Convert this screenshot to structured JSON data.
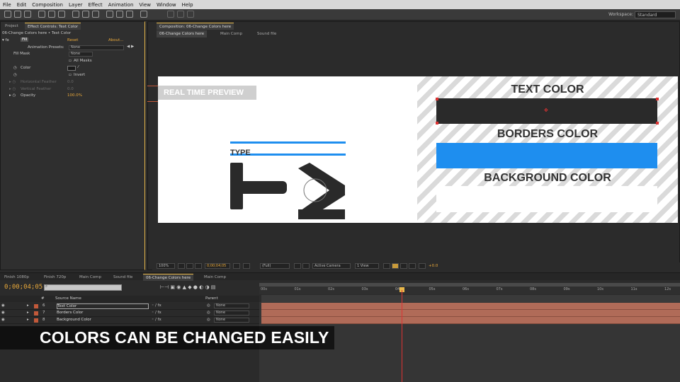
{
  "menu": {
    "items": [
      "File",
      "Edit",
      "Composition",
      "Layer",
      "Effect",
      "Animation",
      "View",
      "Window",
      "Help"
    ]
  },
  "workspace": {
    "label": "Workspace:",
    "value": "Standard"
  },
  "left_panel": {
    "tabs": [
      "Project",
      "Effect Controls: Text Color"
    ],
    "breadcrumb": "06-Change Colors here • Text Color",
    "effect": {
      "name": "Fill",
      "reset": "Reset",
      "about": "About..."
    },
    "animation_presets_label": "Animation Presets:",
    "animation_presets_value": "None",
    "fill_mask_label": "Fill Mask",
    "fill_mask_value": "None",
    "all_masks_label": "All Masks",
    "color_label": "Color",
    "invert_label": "Invert",
    "h_feather_label": "Horizontal Feather",
    "h_feather_value": "0.0",
    "v_feather_label": "Vertical Feather",
    "v_feather_value": "0.0",
    "opacity_label": "Opacity",
    "opacity_value": "100.0%"
  },
  "composition": {
    "panel_tab": "Composition: 06-Change Colors here",
    "tabs": [
      "06-Change Colors here",
      "Main Comp",
      "Sound file"
    ],
    "preview": {
      "badge": "REAL TIME PREVIEW",
      "type_text": "TYPE",
      "text_color_heading": "TEXT COLOR",
      "borders_color_heading": "BORDERS COLOR",
      "background_color_heading": "BACKGROUND COLOR",
      "colors": {
        "text": "#2a2a2a",
        "border": "#1e8eef",
        "background": "#ffffff"
      }
    },
    "viewer_bar": {
      "zoom": "100%",
      "timecode": "0;00;04;05",
      "resolution": "(Full)",
      "camera": "Active Camera",
      "view": "1 View",
      "exposure": "+0.0"
    }
  },
  "timeline": {
    "tabs": [
      "Finish 1080p",
      "Finish 720p",
      "Main Comp",
      "Sound file",
      "06-Change Colors here",
      "Main Comp"
    ],
    "current_time": "0;00;04;05",
    "columns": {
      "num": "#",
      "source": "Source Name",
      "parent": "Parent"
    },
    "layers": [
      {
        "num": "6",
        "name": "Text Color",
        "parent": "None",
        "label_color": "#c2593a"
      },
      {
        "num": "7",
        "name": "Borders Color",
        "parent": "None",
        "label_color": "#c2593a"
      },
      {
        "num": "8",
        "name": "Background Color",
        "parent": "None",
        "label_color": "#c2593a"
      }
    ],
    "ruler_ticks": [
      "00s",
      "01s",
      "02s",
      "03s",
      "04s",
      "05s",
      "06s",
      "07s",
      "08s",
      "09s",
      "10s",
      "11s",
      "12s"
    ]
  },
  "caption": "COLORS CAN BE CHANGED EASILY"
}
